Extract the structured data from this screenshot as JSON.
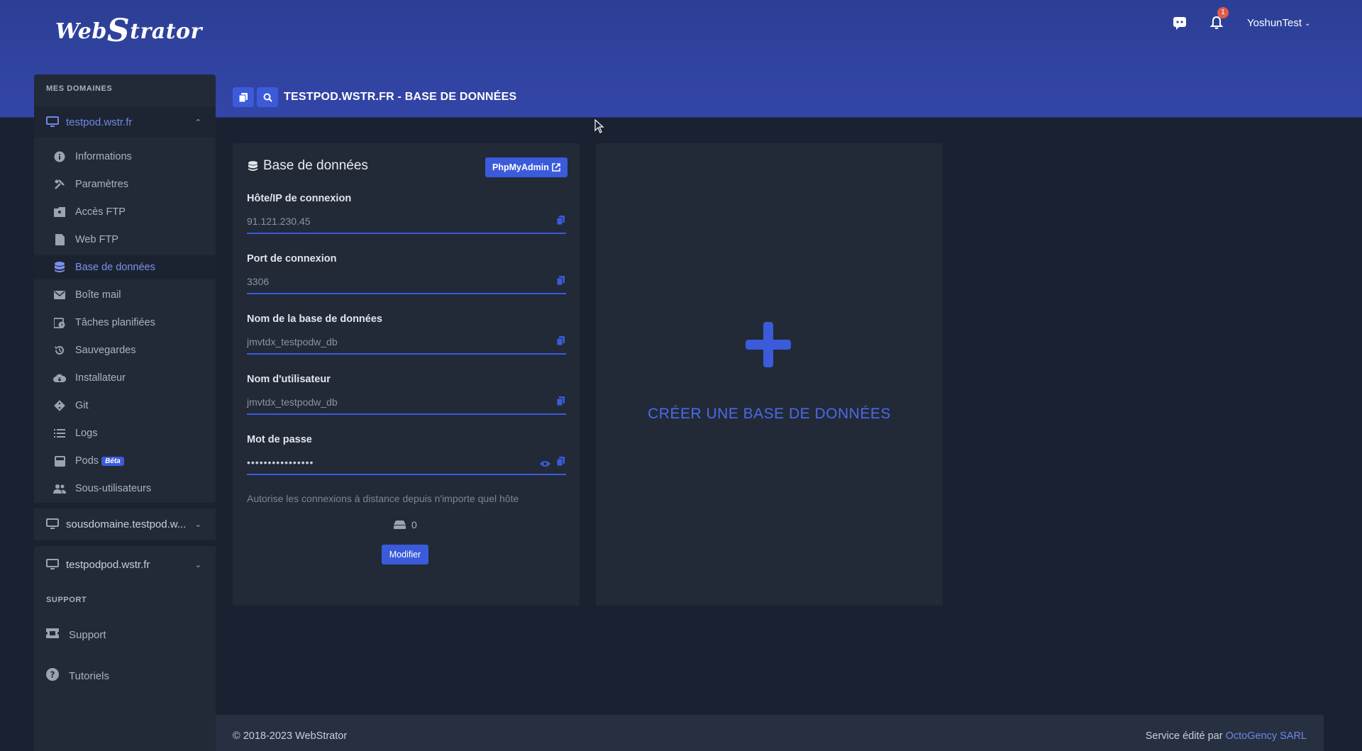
{
  "brand": {
    "logo_text_a": "Web",
    "logo_text_s": "S",
    "logo_text_b": "trator"
  },
  "header": {
    "notification_count": "1",
    "username": "YoshunTest",
    "page_title": "TESTPOD.WSTR.FR - BASE DE DONNÉES"
  },
  "sidebar": {
    "section_domains": "MES DOMAINES",
    "domains": [
      {
        "label": "testpod.wstr.fr"
      },
      {
        "label": "sousdomaine.testpod.w..."
      },
      {
        "label": "testpodpod.wstr.fr"
      }
    ],
    "sub_items": [
      {
        "label": "Informations",
        "icon": "info-icon"
      },
      {
        "label": "Paramètres",
        "icon": "tools-icon"
      },
      {
        "label": "Accès FTP",
        "icon": "folder-user-icon"
      },
      {
        "label": "Web FTP",
        "icon": "file-icon"
      },
      {
        "label": "Base de données",
        "icon": "database-icon"
      },
      {
        "label": "Boîte mail",
        "icon": "mail-icon"
      },
      {
        "label": "Tâches planifiées",
        "icon": "calendar-clock-icon"
      },
      {
        "label": "Sauvegardes",
        "icon": "history-icon"
      },
      {
        "label": "Installateur",
        "icon": "cloud-download-icon"
      },
      {
        "label": "Git",
        "icon": "git-icon"
      },
      {
        "label": "Logs",
        "icon": "list-icon"
      },
      {
        "label": "Pods",
        "icon": "pod-icon"
      },
      {
        "label": "Sous-utilisateurs",
        "icon": "users-icon"
      }
    ],
    "beta_label": "Béta",
    "section_support": "SUPPORT",
    "support_items": [
      {
        "label": "Support",
        "icon": "ticket-icon"
      },
      {
        "label": "Tutoriels",
        "icon": "question-icon"
      }
    ]
  },
  "db_card": {
    "title": "Base de données",
    "phpmyadmin_label": "PhpMyAdmin",
    "fields": [
      {
        "label": "Hôte/IP de connexion",
        "value": "91.121.230.45"
      },
      {
        "label": "Port de connexion",
        "value": "3306"
      },
      {
        "label": "Nom de la base de données",
        "value": "jmvtdx_testpodw_db"
      },
      {
        "label": "Nom d'utilisateur",
        "value": "jmvtdx_testpodw_db"
      },
      {
        "label": "Mot de passe",
        "value": "••••••••••••••••"
      }
    ],
    "remote_text": "Autorise les connexions à distance depuis n'importe quel hôte",
    "remote_count": "0",
    "modify_label": "Modifier"
  },
  "create_card": {
    "label": "CRÉER UNE BASE DE DONNÉES"
  },
  "footer": {
    "copyright": "© 2018-2023 WebStrator",
    "service_prefix": "Service édité par ",
    "company": "OctoGency SARL"
  },
  "colors": {
    "accent": "#3b5bdb",
    "header": "#3346a8",
    "bg": "#1a2130",
    "card": "#222a38"
  }
}
